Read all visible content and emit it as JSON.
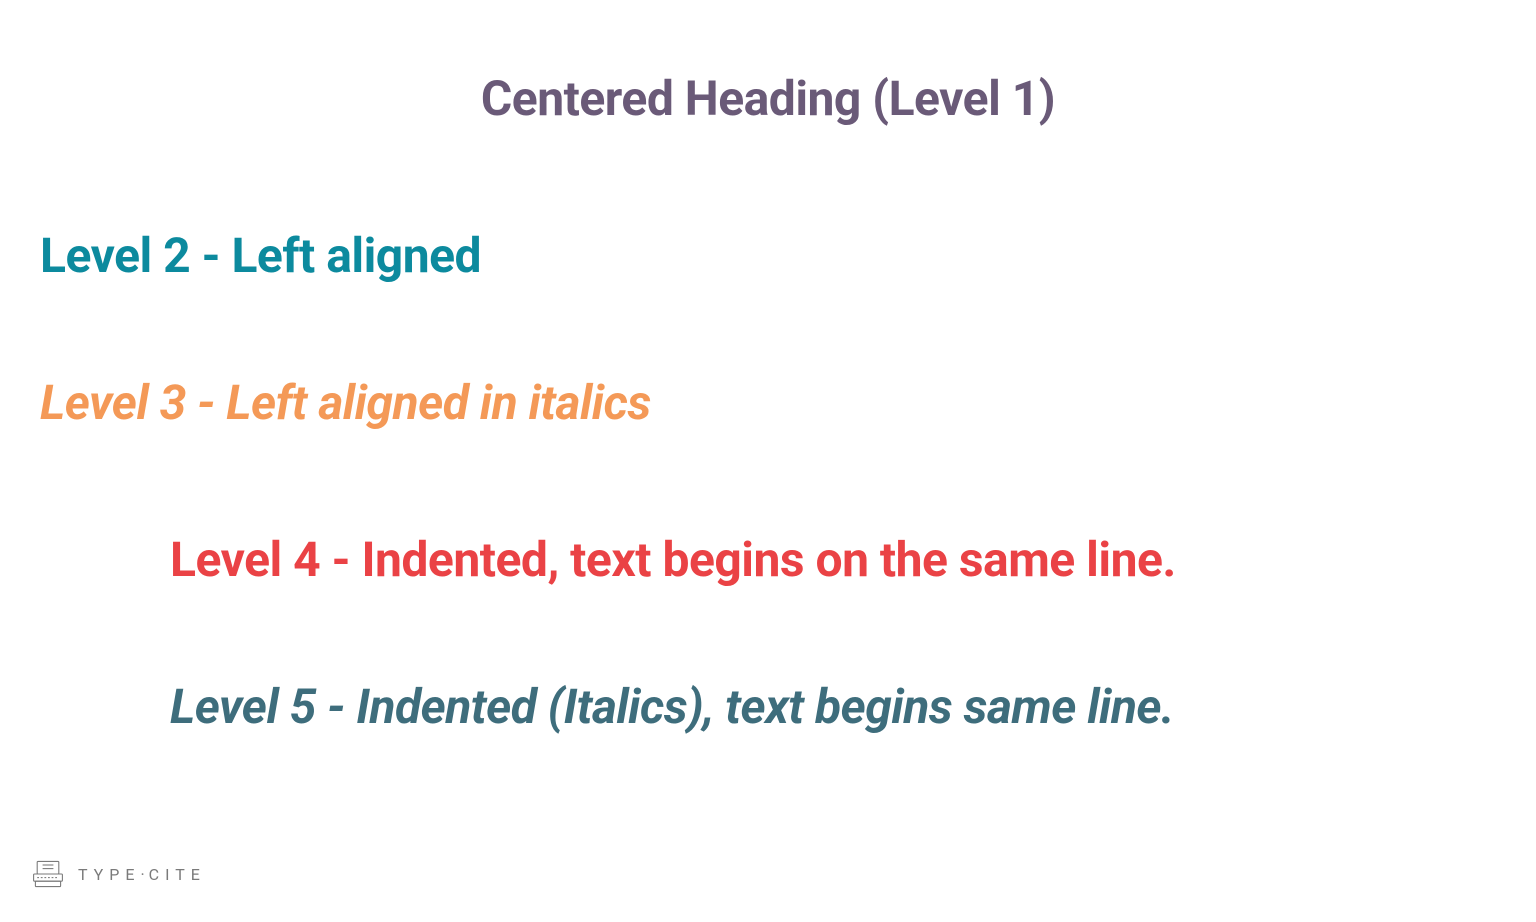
{
  "headings": {
    "level1": "Centered Heading (Level 1)",
    "level2": "Level 2 - Left aligned",
    "level3": "Level 3 - Left aligned in italics",
    "level4": "Level 4 - Indented, text begins on the same line.",
    "level5": "Level 5 - Indented (Italics), text begins same line."
  },
  "logo": {
    "brand_part1": "TYPE",
    "brand_dot": "·",
    "brand_part2": "CITE"
  },
  "colors": {
    "level1": "#6a5a78",
    "level2": "#0c8a9e",
    "level3": "#f49957",
    "level4": "#ea4245",
    "level5": "#3e6d7c"
  }
}
